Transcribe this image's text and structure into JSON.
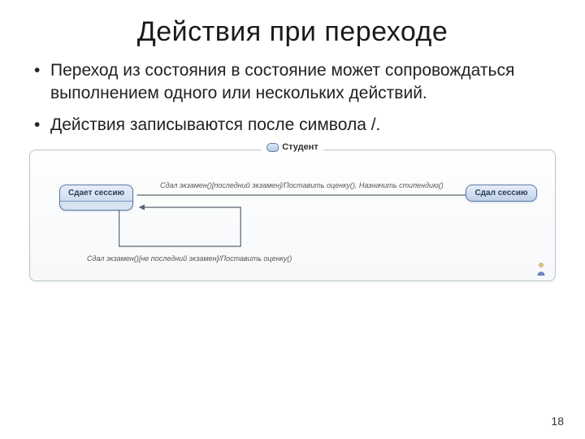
{
  "title": "Действия при переходе",
  "bullets": [
    "Переход из состояния в состояние может сопровождаться выполнением одного или нескольких действий.",
    "Действия записываются после символа /."
  ],
  "diagram": {
    "frame_title": "Студент",
    "state_left": "Сдает сессию",
    "state_right": "Сдал сессию",
    "transition_top": "Сдал экзамен()[последний экзамен]/Поставить оценку(), Назначить стипендию()",
    "transition_bottom": "Сдал экзамен()[не последний экзамен]/Поставить оценку()"
  },
  "page_number": "18"
}
